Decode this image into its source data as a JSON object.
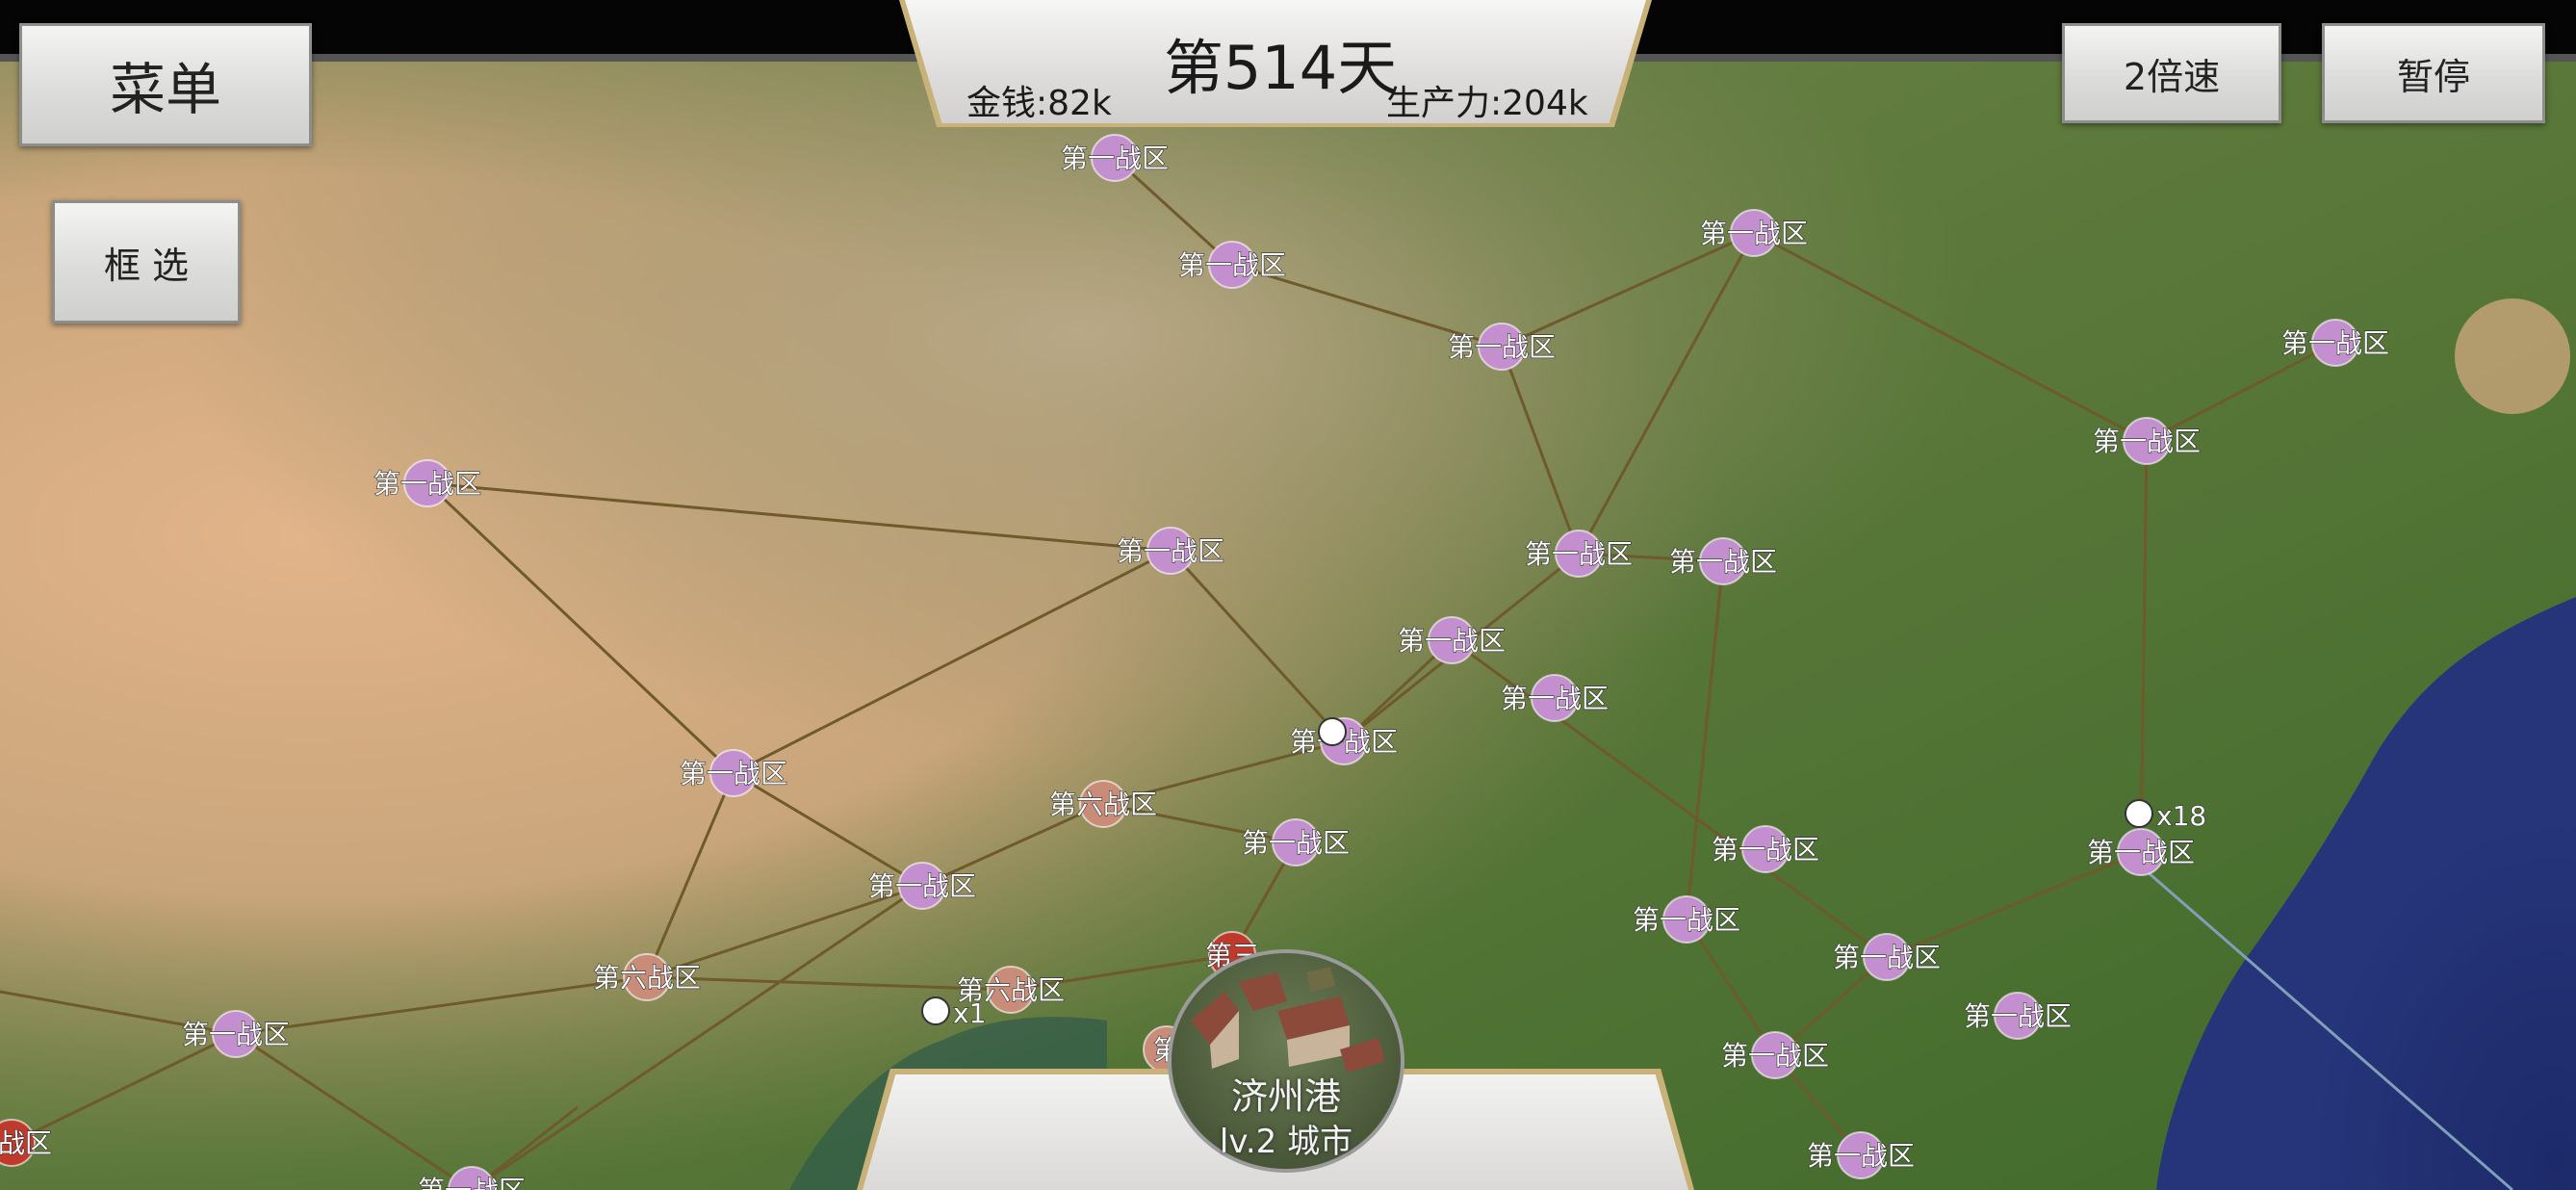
{
  "hud": {
    "day": "第514天",
    "money": "金钱:82k",
    "production": "生产力:204k"
  },
  "buttons": {
    "menu": "菜单",
    "box_select": "框 选",
    "speed": "2倍速",
    "pause": "暂停"
  },
  "selected_city": {
    "name": "济州港",
    "level": "lv.2 城市"
  },
  "colors": {
    "owned_node": "#c48fcf",
    "enemy_node": "#c0392b",
    "contested_node": "#c98c78",
    "route": "#6e5a2a"
  },
  "map": {
    "nodes": [
      {
        "label": "第一战区",
        "state": "owned"
      },
      {
        "label": "第一战区",
        "state": "owned"
      },
      {
        "label": "第一战区",
        "state": "owned"
      },
      {
        "label": "第一战区",
        "state": "owned"
      },
      {
        "label": "第一战区",
        "state": "owned"
      },
      {
        "label": "第一战区",
        "state": "owned"
      },
      {
        "label": "第一战区",
        "state": "owned"
      },
      {
        "label": "第一战区",
        "state": "owned"
      },
      {
        "label": "第一战区",
        "state": "owned"
      },
      {
        "label": "第一战区",
        "state": "owned"
      },
      {
        "label": "第一战区",
        "state": "owned"
      },
      {
        "label": "第一战区",
        "state": "owned"
      },
      {
        "label": "第一战区",
        "state": "owned"
      },
      {
        "label": "第六战区",
        "state": "contested"
      },
      {
        "label": "第一战区",
        "state": "owned"
      },
      {
        "label": "第一战区",
        "state": "owned"
      },
      {
        "label": "第一战区",
        "state": "owned"
      },
      {
        "label": "第一战区",
        "state": "owned"
      },
      {
        "label": "第一战区",
        "state": "owned"
      },
      {
        "label": "第一战区",
        "state": "owned"
      },
      {
        "label": "第一战区",
        "state": "owned"
      },
      {
        "label": "第六战区",
        "state": "contested"
      },
      {
        "label": "第一战区",
        "state": "owned"
      },
      {
        "label": "第一战区",
        "state": "owned"
      },
      {
        "label": "第六战区",
        "state": "contested"
      },
      {
        "label": "第一战区",
        "state": "owned"
      },
      {
        "label": "第一战区",
        "state": "owned"
      },
      {
        "label": "第一战区",
        "state": "owned"
      },
      {
        "label": "三战区",
        "state": "enemy"
      },
      {
        "label": "第三",
        "state": "enemy"
      },
      {
        "label": "第",
        "state": "contested"
      }
    ],
    "unit_markers": [
      "x18",
      "x1"
    ]
  }
}
